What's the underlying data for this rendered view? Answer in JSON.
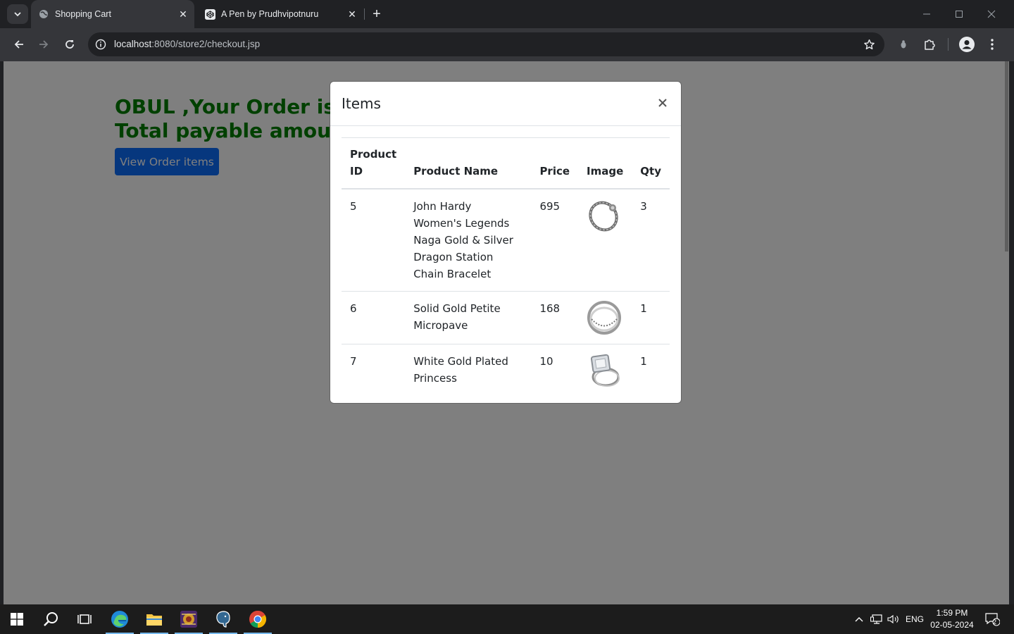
{
  "browser": {
    "tabs": [
      {
        "title": "Shopping Cart",
        "active": true
      },
      {
        "title": "A Pen by Prudhvipotnuru",
        "active": false
      }
    ],
    "url_host": "localhost",
    "url_path": ":8080/store2/checkout.jsp"
  },
  "page": {
    "heading_line1": "OBUL ,Your Order is successfully placed",
    "heading_line2": "Total payable amount is:",
    "view_button": "View Order items",
    "heading_color": "#008000",
    "button_color": "#0d6efd"
  },
  "modal": {
    "title": "Items",
    "columns": [
      "Product ID",
      "Product Name",
      "Price",
      "Image",
      "Qty"
    ],
    "rows": [
      {
        "id": "5",
        "name": "John Hardy Women's Legends Naga Gold & Silver Dragon Station Chain Bracelet",
        "price": "695",
        "image": "bracelet-image",
        "qty": "3"
      },
      {
        "id": "6",
        "name": "Solid Gold Petite Micropave",
        "price": "168",
        "image": "ring-image",
        "qty": "1"
      },
      {
        "id": "7",
        "name": "White Gold Plated Princess",
        "price": "10",
        "image": "princess-ring-image",
        "qty": "1"
      }
    ]
  },
  "taskbar": {
    "lang": "ENG",
    "time": "1:59 PM",
    "date": "02-05-2024",
    "notifications": "2"
  }
}
